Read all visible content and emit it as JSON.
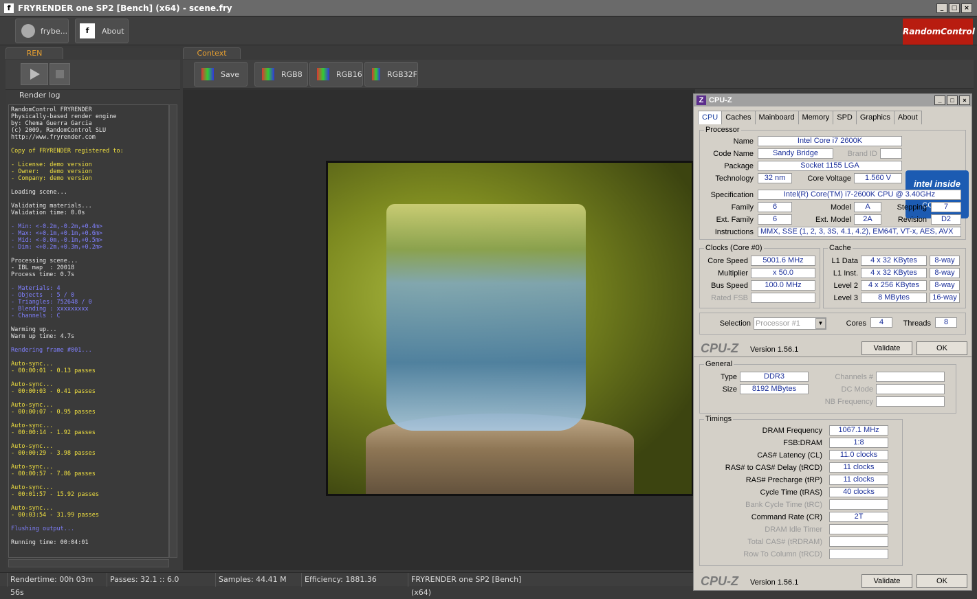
{
  "window": {
    "title": "FRYRENDER one SP2 [Bench] (x64) - scene.fry",
    "icon": "f"
  },
  "toolbar": {
    "user_label": "frybe...",
    "about_label": "About",
    "brand": "RandomControl"
  },
  "tabs": {
    "ren": "REN",
    "context": "Context"
  },
  "renderlog": {
    "label": "Render log",
    "lines": [
      {
        "t": "RandomControl FRYRENDER",
        "c": "w"
      },
      {
        "t": "Physically-based render engine",
        "c": "w"
      },
      {
        "t": "by: Chema Guerra Garcia",
        "c": "w"
      },
      {
        "t": "(c) 2009, RandomControl SLU",
        "c": "w"
      },
      {
        "t": "http://www.fryrender.com",
        "c": "w"
      },
      {
        "t": "",
        "c": "w"
      },
      {
        "t": "Copy of FRYRENDER registered to:",
        "c": "y"
      },
      {
        "t": "",
        "c": "w"
      },
      {
        "t": "- License: demo version",
        "c": "y"
      },
      {
        "t": "- Owner:   demo version",
        "c": "y"
      },
      {
        "t": "- Company: demo version",
        "c": "y"
      },
      {
        "t": "",
        "c": "w"
      },
      {
        "t": "Loading scene...",
        "c": "w"
      },
      {
        "t": "",
        "c": "w"
      },
      {
        "t": "Validating materials...",
        "c": "w"
      },
      {
        "t": "Validation time: 0.0s",
        "c": "w"
      },
      {
        "t": "",
        "c": "w"
      },
      {
        "t": "- Min: <-0.2m,-0.2m,+0.4m>",
        "c": "b"
      },
      {
        "t": "- Max: <+0.1m,+0.1m,+0.6m>",
        "c": "b"
      },
      {
        "t": "- Mid: <-0.0m,-0.1m,+0.5m>",
        "c": "b"
      },
      {
        "t": "- Dim: <+0.2m,+0.3m,+0.2m>",
        "c": "b"
      },
      {
        "t": "",
        "c": "w"
      },
      {
        "t": "Processing scene...",
        "c": "w"
      },
      {
        "t": "- IBL map  : 20018",
        "c": "w"
      },
      {
        "t": "Process time: 0.7s",
        "c": "w"
      },
      {
        "t": "",
        "c": "w"
      },
      {
        "t": "- Materials: 4",
        "c": "b"
      },
      {
        "t": "- Objects  : 5 / 0",
        "c": "b"
      },
      {
        "t": "- Triangles: 752648 / 0",
        "c": "b"
      },
      {
        "t": "- Blending : xxxxxxxxx",
        "c": "b"
      },
      {
        "t": "- Channels : C",
        "c": "b"
      },
      {
        "t": "",
        "c": "w"
      },
      {
        "t": "Warming up...",
        "c": "w"
      },
      {
        "t": "Warm up time: 4.7s",
        "c": "w"
      },
      {
        "t": "",
        "c": "w"
      },
      {
        "t": "Rendering frame #001...",
        "c": "b"
      },
      {
        "t": "",
        "c": "w"
      },
      {
        "t": "Auto-sync...",
        "c": "y"
      },
      {
        "t": "- 00:00:01 - 0.13 passes",
        "c": "y"
      },
      {
        "t": "",
        "c": "w"
      },
      {
        "t": "Auto-sync...",
        "c": "y"
      },
      {
        "t": "- 00:00:03 - 0.41 passes",
        "c": "y"
      },
      {
        "t": "",
        "c": "w"
      },
      {
        "t": "Auto-sync...",
        "c": "y"
      },
      {
        "t": "- 00:00:07 - 0.95 passes",
        "c": "y"
      },
      {
        "t": "",
        "c": "w"
      },
      {
        "t": "Auto-sync...",
        "c": "y"
      },
      {
        "t": "- 00:00:14 - 1.92 passes",
        "c": "y"
      },
      {
        "t": "",
        "c": "w"
      },
      {
        "t": "Auto-sync...",
        "c": "y"
      },
      {
        "t": "- 00:00:29 - 3.98 passes",
        "c": "y"
      },
      {
        "t": "",
        "c": "w"
      },
      {
        "t": "Auto-sync...",
        "c": "y"
      },
      {
        "t": "- 00:00:57 - 7.86 passes",
        "c": "y"
      },
      {
        "t": "",
        "c": "w"
      },
      {
        "t": "Auto-sync...",
        "c": "y"
      },
      {
        "t": "- 00:01:57 - 15.92 passes",
        "c": "y"
      },
      {
        "t": "",
        "c": "w"
      },
      {
        "t": "Auto-sync...",
        "c": "y"
      },
      {
        "t": "- 00:03:54 - 31.99 passes",
        "c": "y"
      },
      {
        "t": "",
        "c": "w"
      },
      {
        "t": "Flushing output...",
        "c": "b"
      },
      {
        "t": "",
        "c": "w"
      },
      {
        "t": "Running time: 00:04:01",
        "c": "w"
      }
    ]
  },
  "context_toolbar": {
    "save": "Save",
    "rgb8": "RGB8",
    "rgb16": "RGB16",
    "rgb32f": "RGB32F"
  },
  "status": {
    "rendertime": "Rendertime: 00h 03m 56s",
    "passes": "Passes: 32.1 :: 6.0",
    "samples": "Samples: 44.41 M",
    "efficiency": "Efficiency: 1881.36",
    "product": "FRYRENDER one SP2 [Bench] (x64)"
  },
  "cpuz": {
    "title": "CPU-Z",
    "tabs": [
      "CPU",
      "Caches",
      "Mainboard",
      "Memory",
      "SPD",
      "Graphics",
      "About"
    ],
    "processor": {
      "group": "Processor",
      "name_l": "Name",
      "name": "Intel Core i7 2600K",
      "codename_l": "Code Name",
      "codename": "Sandy Bridge",
      "brandid_l": "Brand ID",
      "package_l": "Package",
      "package": "Socket 1155 LGA",
      "tech_l": "Technology",
      "tech": "32 nm",
      "cv_l": "Core Voltage",
      "cv": "1.560 V",
      "spec_l": "Specification",
      "spec": "Intel(R) Core(TM) i7-2600K CPU @ 3.40GHz",
      "family_l": "Family",
      "family": "6",
      "model_l": "Model",
      "model": "A",
      "stepping_l": "Stepping",
      "stepping": "7",
      "extfam_l": "Ext. Family",
      "extfam": "6",
      "extmodel_l": "Ext. Model",
      "extmodel": "2A",
      "revision_l": "Revision",
      "revision": "D2",
      "instr_l": "Instructions",
      "instr": "MMX, SSE (1, 2, 3, 3S, 4.1, 4.2), EM64T, VT-x, AES, AVX",
      "intel_inside": "intel inside",
      "intel_core": "CORE i7"
    },
    "clocks": {
      "group": "Clocks (Core #0)",
      "cs_l": "Core Speed",
      "cs": "5001.6 MHz",
      "mult_l": "Multiplier",
      "mult": "x 50.0",
      "bus_l": "Bus Speed",
      "bus": "100.0 MHz",
      "fsb_l": "Rated FSB"
    },
    "cache": {
      "group": "Cache",
      "l1d_l": "L1 Data",
      "l1d": "4 x 32 KBytes",
      "l1d_w": "8-way",
      "l1i_l": "L1 Inst.",
      "l1i": "4 x 32 KBytes",
      "l1i_w": "8-way",
      "l2_l": "Level 2",
      "l2": "4 x 256 KBytes",
      "l2_w": "8-way",
      "l3_l": "Level 3",
      "l3": "8 MBytes",
      "l3_w": "16-way"
    },
    "selection": {
      "label": "Selection",
      "value": "Processor #1",
      "cores_l": "Cores",
      "cores": "4",
      "threads_l": "Threads",
      "threads": "8"
    },
    "footer": {
      "logo": "CPU-Z",
      "version": "Version 1.56.1",
      "validate": "Validate",
      "ok": "OK"
    }
  },
  "memory": {
    "general": "General",
    "type_l": "Type",
    "type": "DDR3",
    "size_l": "Size",
    "size": "8192 MBytes",
    "channels_l": "Channels #",
    "dcmode_l": "DC Mode",
    "nbfreq_l": "NB Frequency",
    "timings": "Timings",
    "rows": [
      {
        "l": "DRAM Frequency",
        "v": "1067.1 MHz",
        "d": false
      },
      {
        "l": "FSB:DRAM",
        "v": "1:8",
        "d": false
      },
      {
        "l": "CAS# Latency (CL)",
        "v": "11.0 clocks",
        "d": false
      },
      {
        "l": "RAS# to CAS# Delay (tRCD)",
        "v": "11 clocks",
        "d": false
      },
      {
        "l": "RAS# Precharge (tRP)",
        "v": "11 clocks",
        "d": false
      },
      {
        "l": "Cycle Time (tRAS)",
        "v": "40 clocks",
        "d": false
      },
      {
        "l": "Bank Cycle Time (tRC)",
        "v": "",
        "d": true
      },
      {
        "l": "Command Rate (CR)",
        "v": "2T",
        "d": false
      },
      {
        "l": "DRAM Idle Timer",
        "v": "",
        "d": true
      },
      {
        "l": "Total CAS# (tRDRAM)",
        "v": "",
        "d": true
      },
      {
        "l": "Row To Column (tRCD)",
        "v": "",
        "d": true
      }
    ],
    "footer": {
      "logo": "CPU-Z",
      "version": "Version 1.56.1",
      "validate": "Validate",
      "ok": "OK"
    }
  }
}
